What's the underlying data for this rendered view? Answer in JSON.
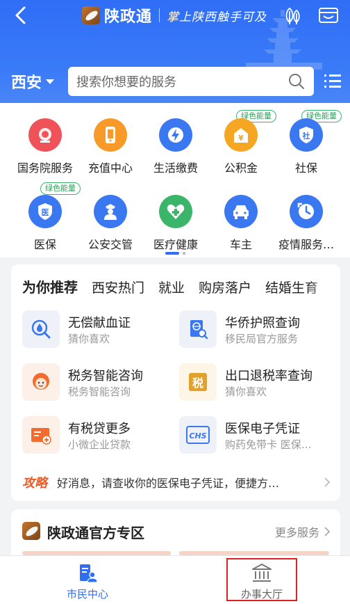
{
  "header": {
    "app_name": "陕政通",
    "slogan": "掌上陕西触手可及",
    "city": "西安",
    "search_placeholder": "搜索你想要的服务"
  },
  "services": [
    {
      "label": "国务院服务",
      "icon": "state-council-icon",
      "color": "#f0525a"
    },
    {
      "label": "充值中心",
      "icon": "phone-recharge-icon",
      "color": "#f79a2a"
    },
    {
      "label": "生活缴费",
      "icon": "lightning-icon",
      "color": "#3a78f2"
    },
    {
      "label": "公积金",
      "icon": "provident-fund-icon",
      "color": "#f5a623",
      "badge": "绿色能量"
    },
    {
      "label": "社保",
      "icon": "social-security-icon",
      "color": "#3a78f2",
      "badge": "绿色能量"
    },
    {
      "label": "医保",
      "icon": "medical-insurance-icon",
      "color": "#3a78f2",
      "badge": "绿色能量"
    },
    {
      "label": "公安交管",
      "icon": "police-icon",
      "color": "#3a78f2"
    },
    {
      "label": "医疗健康",
      "icon": "health-icon",
      "color": "#3bb56a"
    },
    {
      "label": "车主",
      "icon": "car-icon",
      "color": "#3a78f2"
    },
    {
      "label": "疫情服务…",
      "icon": "clock-icon",
      "color": "#3a78f2"
    }
  ],
  "recommend": {
    "tabs": [
      "为你推荐",
      "西安热门",
      "就业",
      "购房落户",
      "结婚生育"
    ],
    "items": [
      {
        "title": "无偿献血证",
        "sub": "猜你喜欢",
        "icon": "blood-donation-icon"
      },
      {
        "title": "华侨护照查询",
        "sub": "移民局官方服务",
        "icon": "passport-search-icon"
      },
      {
        "title": "税务智能咨询",
        "sub": "税务智能咨询",
        "icon": "tax-assistant-icon"
      },
      {
        "title": "出口退税率查询",
        "sub": "猜你喜欢",
        "icon": "tax-refund-icon"
      },
      {
        "title": "有税贷更多",
        "sub": "小微企业贷款",
        "icon": "loan-card-icon"
      },
      {
        "title": "医保电子凭证",
        "sub": "购药免带卡 医保…",
        "icon": "chs-icon"
      }
    ],
    "tip_tag": "攻略",
    "tip_text": "好消息，请查收你的医保电子凭证，便捷方…"
  },
  "zone": {
    "title": "陕政通官方专区",
    "more": "更多服务"
  },
  "nav": {
    "citizen": "市民中心",
    "hall": "办事大厅"
  },
  "colors": {
    "primary": "#2f6ef6",
    "green_badge": "#2ea25c",
    "tip": "#ee5a24",
    "highlight": "#e02020"
  }
}
